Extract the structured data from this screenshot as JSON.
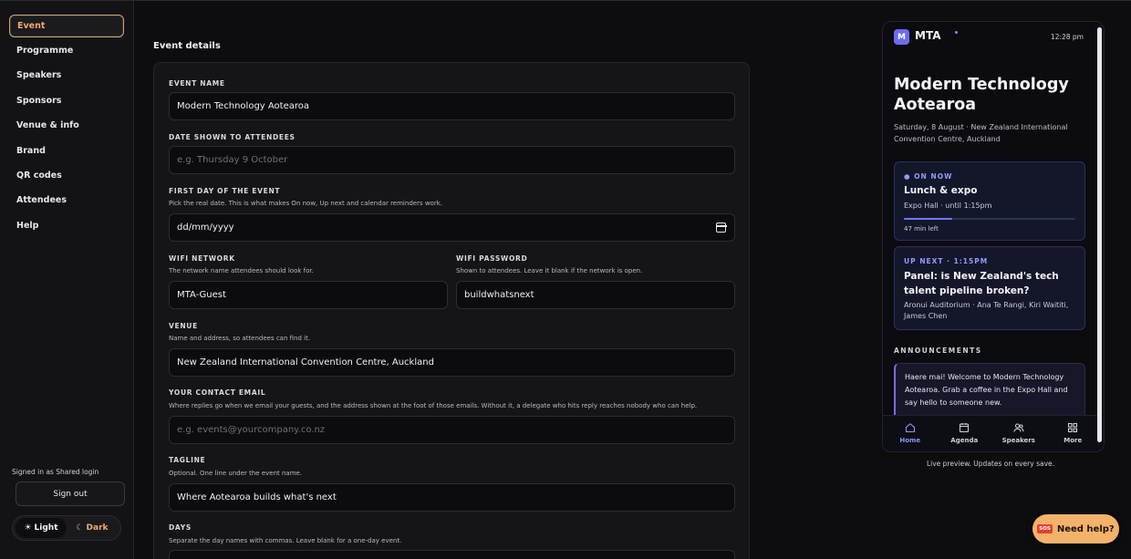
{
  "sidebar": {
    "items": [
      {
        "label": "Event",
        "active": true
      },
      {
        "label": "Programme"
      },
      {
        "label": "Speakers"
      },
      {
        "label": "Sponsors"
      },
      {
        "label": "Venue & info"
      },
      {
        "label": "Brand"
      },
      {
        "label": "QR codes"
      },
      {
        "label": "Attendees"
      },
      {
        "label": "Help"
      }
    ],
    "signed_in": "Signed in as Shared login",
    "sign_out": "Sign out",
    "theme": {
      "light": "Light",
      "dark": "Dark",
      "selected": "dark"
    }
  },
  "main": {
    "section_title": "Event details",
    "fields": {
      "event_name": {
        "label": "EVENT NAME",
        "value": "Modern Technology Aotearoa"
      },
      "date_shown": {
        "label": "DATE SHOWN TO ATTENDEES",
        "placeholder": "e.g. Thursday 9 October"
      },
      "first_day": {
        "label": "FIRST DAY OF THE EVENT",
        "hint": "Pick the real date. This is what makes On now, Up next and calendar reminders work.",
        "value": "dd/mm/yyyy"
      },
      "wifi_network": {
        "label": "WIFI NETWORK",
        "hint": "The network name attendees should look for.",
        "value": "MTA-Guest"
      },
      "wifi_password": {
        "label": "WIFI PASSWORD",
        "hint": "Shown to attendees. Leave it blank if the network is open.",
        "value": "buildwhatsnext"
      },
      "venue": {
        "label": "VENUE",
        "hint": "Name and address, so attendees can find it.",
        "value": "New Zealand International Convention Centre, Auckland"
      },
      "contact_email": {
        "label": "YOUR CONTACT EMAIL",
        "hint": "Where replies go when we email your guests, and the address shown at the foot of those emails. Without it, a delegate who hits reply reaches nobody who can help.",
        "placeholder": "e.g. events@yourcompany.co.nz"
      },
      "tagline": {
        "label": "TAGLINE",
        "hint": "Optional. One line under the event name.",
        "value": "Where Aotearoa builds what's next"
      },
      "days": {
        "label": "DAYS",
        "hint": "Separate the day names with commas. Leave blank for a one-day event."
      }
    }
  },
  "preview": {
    "logo_letter": "M",
    "brand": "MTA",
    "time": "12:28 pm",
    "title": "Modern Technology Aotearoa",
    "subtitle": "Saturday, 8 August · New Zealand International Convention Centre, Auckland",
    "on_now": {
      "kicker": "ON NOW",
      "title": "Lunch & expo",
      "meta": "Expo Hall · until 1:15pm",
      "progress": 0.28,
      "left": "47 min left"
    },
    "up_next": {
      "kicker": "UP NEXT · 1:15PM",
      "title": "Panel: is New Zealand's tech talent pipeline broken?",
      "meta": "Aronui Auditorium · Ana Te Rangi, Kiri Waititi, James Chen"
    },
    "announcements_label": "ANNOUNCEMENTS",
    "announcement": "Haere mai! Welcome to Modern Technology Aotearoa. Grab a coffee in the Expo Hall and say hello to someone new.",
    "tabs": [
      {
        "label": "Home",
        "icon": "home-icon",
        "active": true
      },
      {
        "label": "Agenda",
        "icon": "calendar-icon"
      },
      {
        "label": "Speakers",
        "icon": "people-icon"
      },
      {
        "label": "More",
        "icon": "grid-icon"
      }
    ],
    "caption": "Live preview. Updates on every save."
  },
  "help": {
    "badge": "SOS",
    "label": "Need help?"
  },
  "colors": {
    "accent": "#f0a96a",
    "preview_accent": "#8a96ff",
    "help_button": "#f5b26a"
  }
}
